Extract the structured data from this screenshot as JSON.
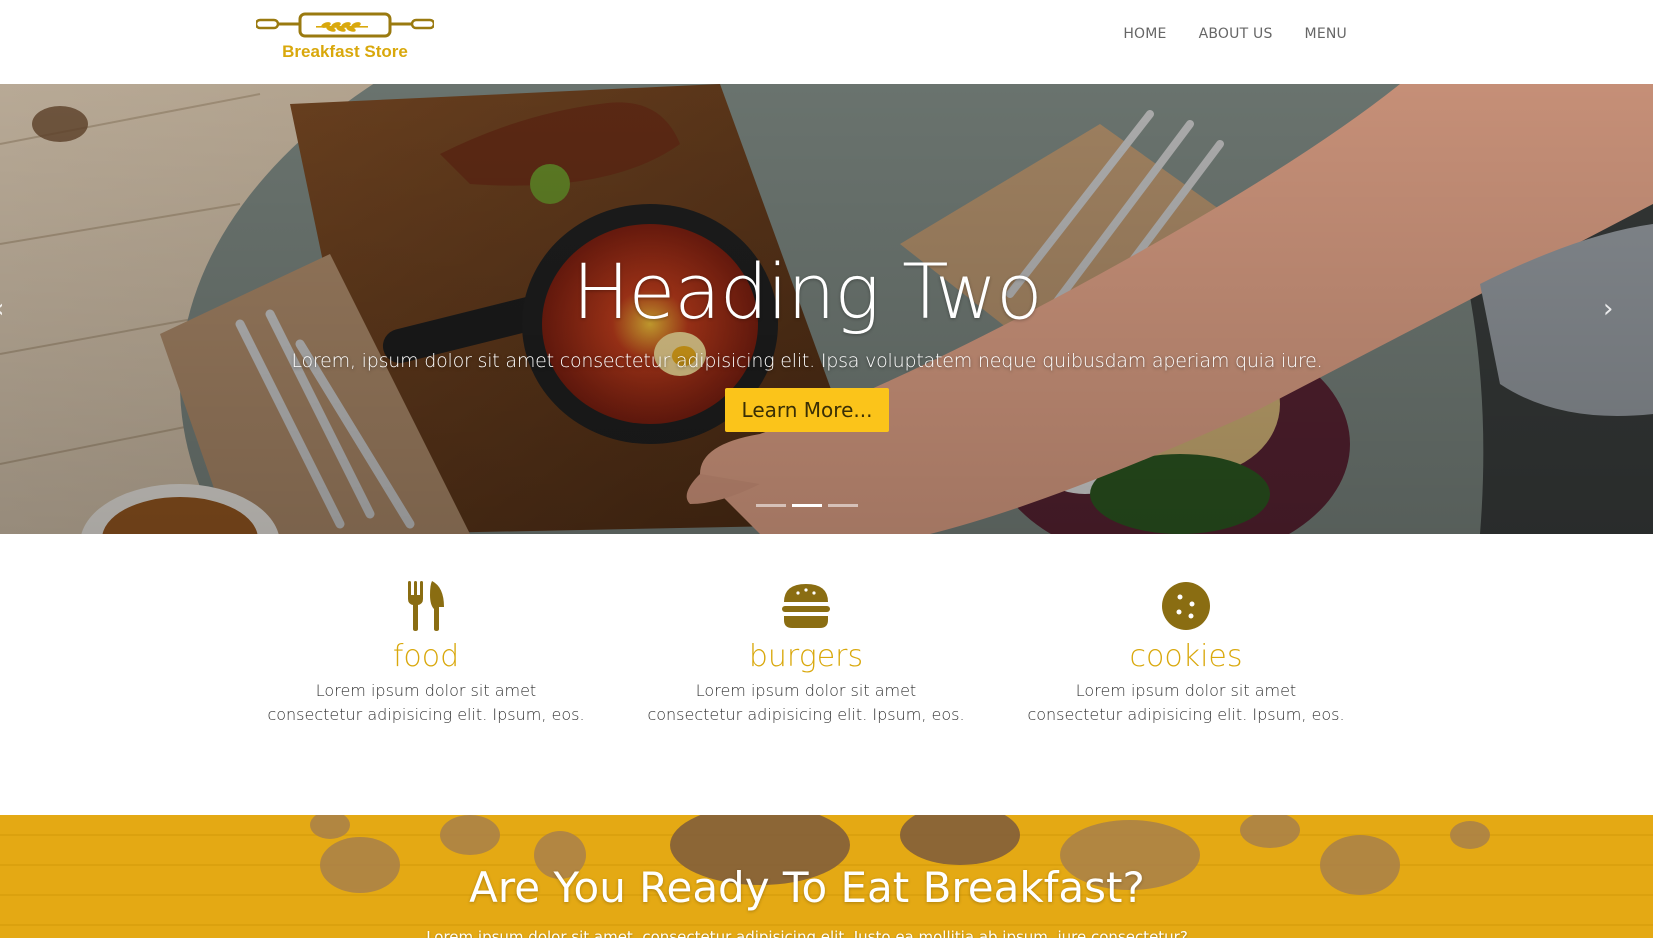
{
  "brand": {
    "name": "Breakfast Store",
    "icon": "rolling-pin-wheat-icon",
    "color": "#d9a80c"
  },
  "nav": {
    "items": [
      "HOME",
      "ABOUT US",
      "MENU"
    ]
  },
  "hero": {
    "title": "Heading Two",
    "subtitle": "Lorem, ipsum dolor sit amet consectetur adipisicing elit. Ipsa voluptatem neque quibusdam aperiam quia iure.",
    "button_label": "Learn More...",
    "button_color": "#fbc41a",
    "slide_count": 3,
    "active_slide": 2,
    "prev_icon": "chevron-left-icon",
    "next_icon": "chevron-right-icon"
  },
  "features": [
    {
      "icon": "utensils-icon",
      "title": "food",
      "text": "Lorem ipsum dolor sit amet consectetur adipisicing elit. Ipsum, eos."
    },
    {
      "icon": "burger-icon",
      "title": "burgers",
      "text": "Lorem ipsum dolor sit amet consectetur adipisicing elit. Ipsum, eos."
    },
    {
      "icon": "cookie-icon",
      "title": "cookies",
      "text": "Lorem ipsum dolor sit amet consectetur adipisicing elit. Ipsum, eos."
    }
  ],
  "cta": {
    "title": "Are You Ready To Eat Breakfast?",
    "subtitle": "Lorem ipsum dolor sit amet, consectetur adipisicing elit. Iusto ea mollitia ab ipsum, iure consectetur?",
    "background_color": "#e4a914"
  },
  "colors": {
    "accent": "#d9a80c",
    "icon": "#8a6d12",
    "text": "#333333"
  }
}
